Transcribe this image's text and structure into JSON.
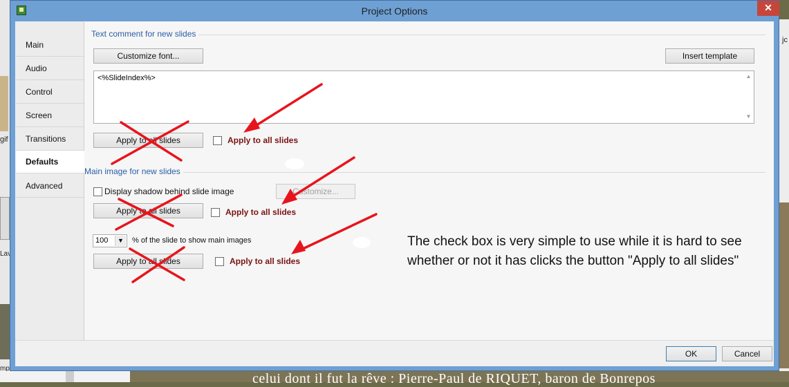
{
  "window": {
    "title": "Project Options",
    "close_glyph": "✕"
  },
  "sidebar": {
    "items": [
      {
        "label": "Main"
      },
      {
        "label": "Audio"
      },
      {
        "label": "Control"
      },
      {
        "label": "Screen"
      },
      {
        "label": "Transitions"
      },
      {
        "label": "Defaults",
        "active": true
      },
      {
        "label": "Advanced"
      }
    ]
  },
  "text_comment": {
    "group_label": "Text comment for new slides",
    "customize_font_button": "Customize font...",
    "insert_template_button": "Insert template",
    "comment_value": "<%SlideIndex%>",
    "apply_button": "Apply to all slides",
    "apply_checkbox_label": "Apply to all slides",
    "apply_checked": false
  },
  "main_image": {
    "group_label": "Main image for new slides",
    "shadow_checkbox_label": "Display shadow behind slide image",
    "shadow_checked": false,
    "customize_button": "Customize...",
    "apply_button_1": "Apply to all slides",
    "apply_checkbox_label_1": "Apply to all slides",
    "apply_checked_1": false,
    "percent_value": "100",
    "percent_label": "% of the slide to show main images",
    "apply_button_2": "Apply to all slides",
    "apply_checkbox_label_2": "Apply to all slides",
    "apply_checked_2": false
  },
  "annotation": {
    "text": "The check box is very simple to use while it is hard to see whether or not it has clicks the button \"Apply to all slides\""
  },
  "footer": {
    "ok_button": "OK",
    "cancel_button": "Cancel"
  },
  "background": {
    "left_text_1": "gif",
    "left_text_2": "Lav",
    "left_text_3": "mp",
    "right_text": "jc",
    "caption": "celui dont il fut la rêve : Pierre-Paul de RIQUET, baron de Bonrepos"
  },
  "colors": {
    "titlebar": "#6ea0d4",
    "close_button": "#c7463b",
    "group_label": "#2a5ea6",
    "apply_label": "#7a1212",
    "annotation_arrow": "#e8141c"
  }
}
